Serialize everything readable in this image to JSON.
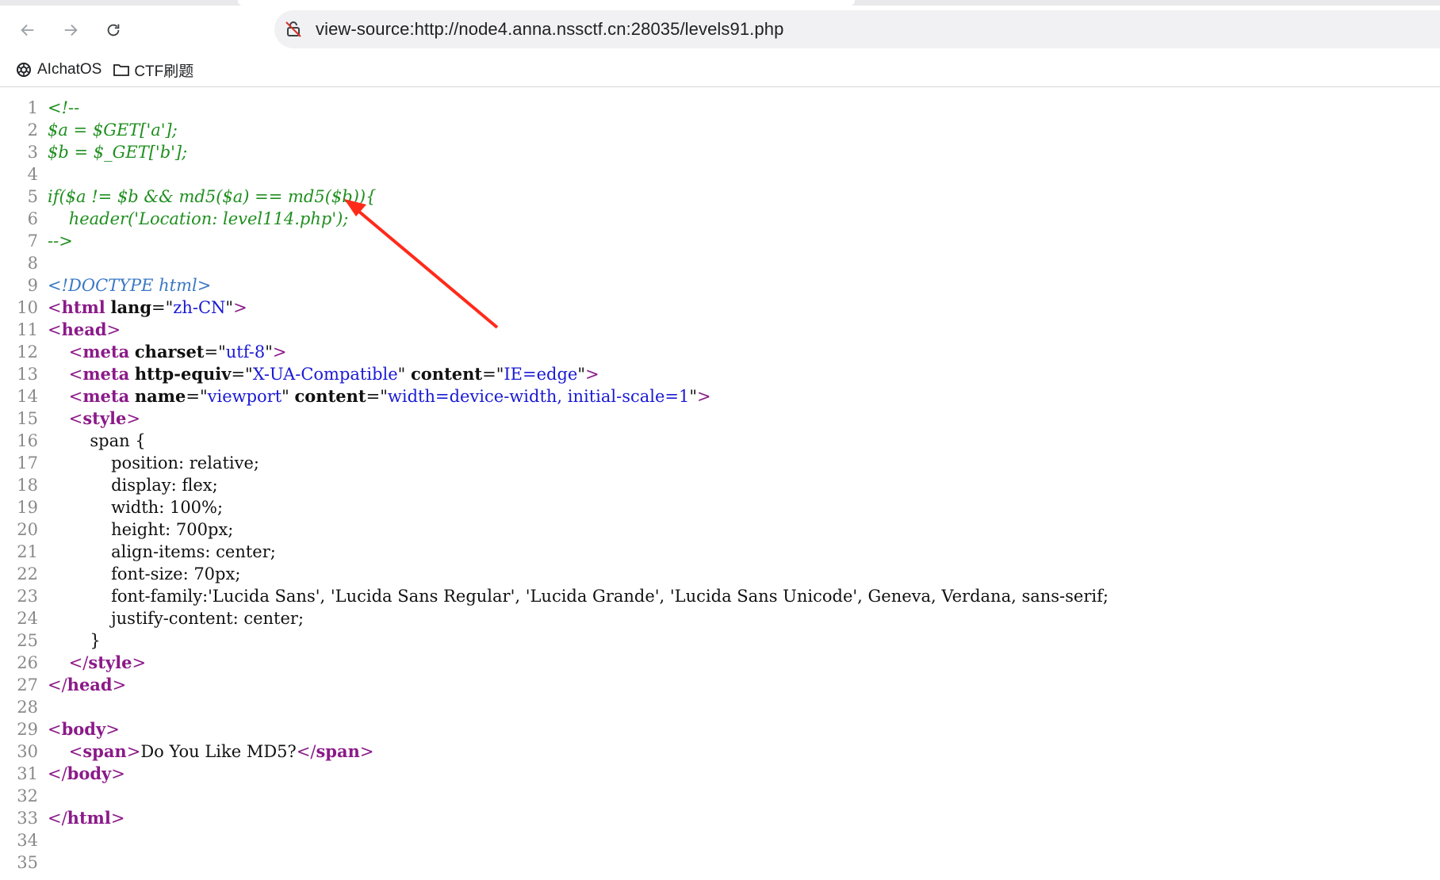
{
  "browser": {
    "url": "view-source:http://node4.anna.nssctf.cn:28035/levels91.php",
    "nav": {
      "back": "back-arrow-icon",
      "forward": "forward-arrow-icon",
      "reload": "reload-icon",
      "security": "not-secure-icon"
    }
  },
  "bookmarks": [
    {
      "label": "AIchatOS",
      "icon": "openai-icon"
    },
    {
      "label": "CTF刷题",
      "icon": "folder-icon"
    }
  ],
  "source": {
    "line_numbers": [
      "1",
      "2",
      "3",
      "4",
      "5",
      "6",
      "7",
      "8",
      "9",
      "10",
      "11",
      "12",
      "13",
      "14",
      "15",
      "16",
      "17",
      "18",
      "19",
      "20",
      "21",
      "22",
      "23",
      "24",
      "25",
      "26",
      "27",
      "28",
      "29",
      "30",
      "31",
      "32",
      "33",
      "34",
      "35"
    ],
    "comment_lines": [
      "<!--",
      "$a = $GET['a'];",
      "$b = $_GET['b'];",
      "",
      "if($a != $b && md5($a) == md5($b)){",
      "    header('Location: level114.php');",
      "-->"
    ],
    "doctype": "<!DOCTYPE html>",
    "html_lang_value": "zh-CN",
    "meta_charset_value": "utf-8",
    "meta_http_equiv_value": "X-UA-Compatible",
    "meta_http_equiv_content": "IE=edge",
    "meta_viewport_name": "viewport",
    "meta_viewport_content": "width=device-width, initial-scale=1",
    "css_selector": "span {",
    "css_props": [
      "position: relative;",
      "display: flex;",
      "width: 100%;",
      "height: 700px;",
      "align-items: center;",
      "font-size: 70px;",
      "font-family:'Lucida Sans', 'Lucida Sans Regular', 'Lucida Grande', 'Lucida Sans Unicode', Geneva, Verdana, sans-serif;",
      "justify-content: center;"
    ],
    "css_close": "}",
    "span_text": "Do You Like MD5?"
  },
  "annotation": {
    "color": "#ff2a1a",
    "icon": "red-arrow-annotation"
  }
}
